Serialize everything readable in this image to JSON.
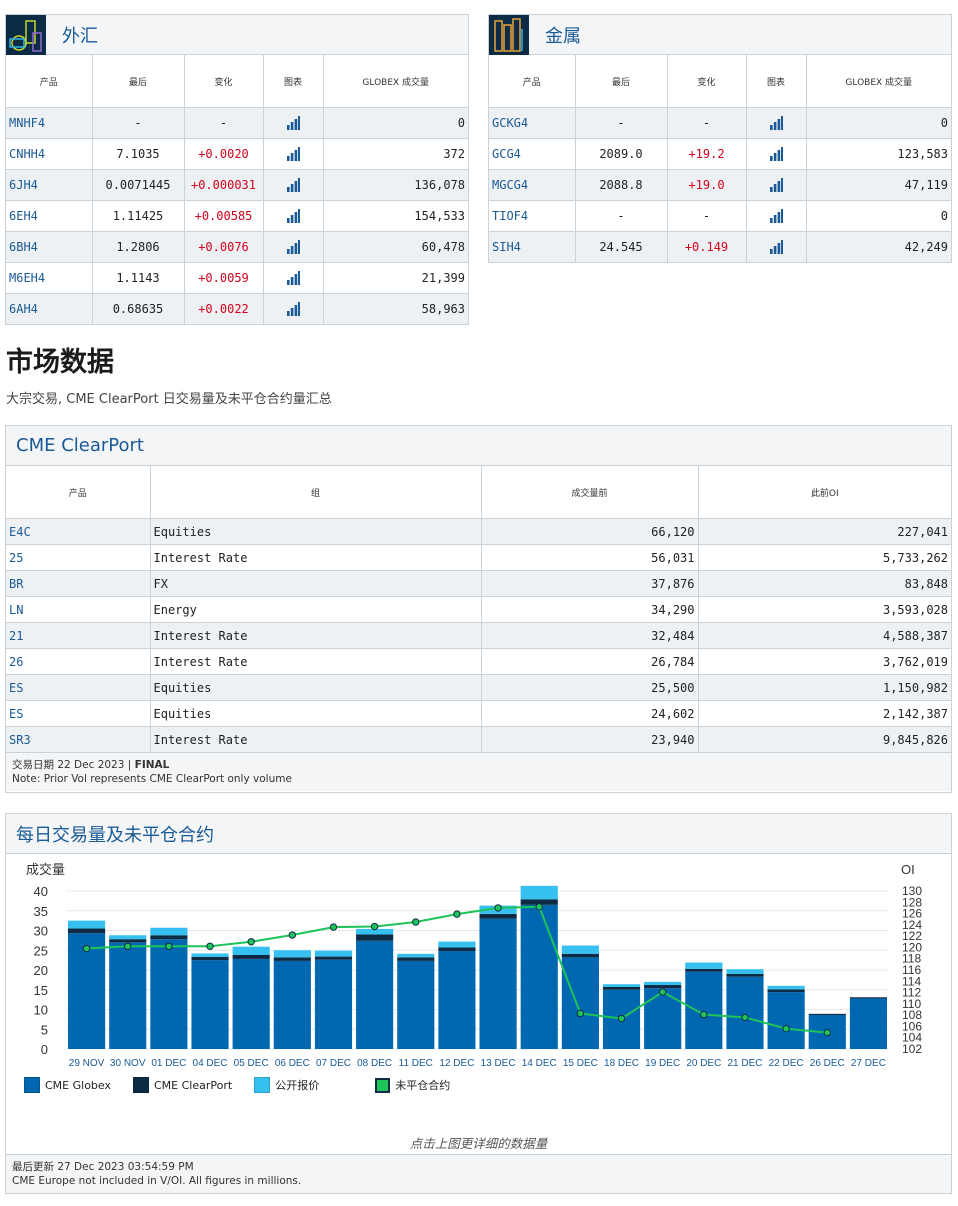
{
  "fx": {
    "title": "外汇",
    "headers": [
      "产品",
      "最后",
      "变化",
      "图表",
      "GLOBEX 成交量"
    ],
    "rows": [
      {
        "code": "MNHF4",
        "last": "-",
        "change": "-",
        "volume": "0"
      },
      {
        "code": "CNHH4",
        "last": "7.1035",
        "change": "+0.0020",
        "volume": "372"
      },
      {
        "code": "6JH4",
        "last": "0.0071445",
        "change": "+0.000031",
        "volume": "136,078"
      },
      {
        "code": "6EH4",
        "last": "1.11425",
        "change": "+0.00585",
        "volume": "154,533"
      },
      {
        "code": "6BH4",
        "last": "1.2806",
        "change": "+0.0076",
        "volume": "60,478"
      },
      {
        "code": "M6EH4",
        "last": "1.1143",
        "change": "+0.0059",
        "volume": "21,399"
      },
      {
        "code": "6AH4",
        "last": "0.68635",
        "change": "+0.0022",
        "volume": "58,963"
      }
    ]
  },
  "metals": {
    "title": "金属",
    "headers": [
      "产品",
      "最后",
      "变化",
      "图表",
      "GLOBEX 成交量"
    ],
    "rows": [
      {
        "code": "GCKG4",
        "last": "-",
        "change": "-",
        "volume": "0"
      },
      {
        "code": "GCG4",
        "last": "2089.0",
        "change": "+19.2",
        "volume": "123,583"
      },
      {
        "code": "MGCG4",
        "last": "2088.8",
        "change": "+19.0",
        "volume": "47,119"
      },
      {
        "code": "TIOF4",
        "last": "-",
        "change": "-",
        "volume": "0"
      },
      {
        "code": "SIH4",
        "last": "24.545",
        "change": "+0.149",
        "volume": "42,249"
      }
    ]
  },
  "market": {
    "title": "市场数据",
    "subtitle": "大宗交易, CME ClearPort 日交易量及未平仓合约量汇总"
  },
  "clearport": {
    "title": "CME ClearPort",
    "headers": [
      "产品",
      "组",
      "成交量前",
      "此前OI"
    ],
    "rows": [
      {
        "code": "E4C",
        "group": "Equities",
        "vol": "66,120",
        "oi": "227,041"
      },
      {
        "code": "25",
        "group": "Interest Rate",
        "vol": "56,031",
        "oi": "5,733,262"
      },
      {
        "code": "BR",
        "group": "FX",
        "vol": "37,876",
        "oi": "83,848"
      },
      {
        "code": "LN",
        "group": "Energy",
        "vol": "34,290",
        "oi": "3,593,028"
      },
      {
        "code": "21",
        "group": "Interest Rate",
        "vol": "32,484",
        "oi": "4,588,387"
      },
      {
        "code": "26",
        "group": "Interest Rate",
        "vol": "26,784",
        "oi": "3,762,019"
      },
      {
        "code": "ES",
        "group": "Equities",
        "vol": "25,500",
        "oi": "1,150,982"
      },
      {
        "code": "ES",
        "group": "Equities",
        "vol": "24,602",
        "oi": "2,142,387"
      },
      {
        "code": "SR3",
        "group": "Interest Rate",
        "vol": "23,940",
        "oi": "9,845,826"
      }
    ],
    "trade_date_label": "交易日期 22 Dec 2023 |",
    "trade_date_status": "FINAL",
    "note": "Note: Prior Vol represents CME ClearPort only volume"
  },
  "daily": {
    "title": "每日交易量及未平仓合约",
    "click_hint": "点击上图更详细的数据量",
    "last_updated": "最后更新 27 Dec 2023 03:54:59 PM",
    "note": "CME Europe not included in V/OI. All figures in millions."
  },
  "colors": {
    "globex": "#0067b1",
    "clearport": "#0d2b45",
    "otc": "#35c0ef",
    "oi": "#1ec35a",
    "link": "#1a5a96",
    "positive": "#d0021b"
  },
  "chart_data": {
    "type": "bar",
    "ylabel": "成交量",
    "y2label": "OI",
    "ylim": [
      0,
      40
    ],
    "yticks": [
      0,
      5,
      10,
      15,
      20,
      25,
      30,
      35,
      40
    ],
    "y2lim": [
      102,
      130
    ],
    "y2ticks": [
      102,
      104,
      106,
      108,
      110,
      112,
      114,
      116,
      118,
      120,
      122,
      124,
      126,
      128,
      130
    ],
    "categories": [
      "29 NOV",
      "30 NOV",
      "01 DEC",
      "04 DEC",
      "05 DEC",
      "06 DEC",
      "07 DEC",
      "08 DEC",
      "11 DEC",
      "12 DEC",
      "13 DEC",
      "14 DEC",
      "15 DEC",
      "18 DEC",
      "19 DEC",
      "20 DEC",
      "21 DEC",
      "22 DEC",
      "26 DEC",
      "27 DEC"
    ],
    "series": [
      {
        "name": "CME Globex",
        "stack": true,
        "values": [
          29.3,
          27.0,
          27.8,
          22.5,
          22.8,
          22.3,
          22.6,
          27.4,
          22.3,
          24.8,
          33.0,
          36.5,
          23.2,
          15.0,
          15.4,
          19.6,
          18.3,
          14.4,
          8.6,
          12.8
        ]
      },
      {
        "name": "CME ClearPort",
        "stack": true,
        "values": [
          1.2,
          0.8,
          1.0,
          0.8,
          1.0,
          0.9,
          0.8,
          1.6,
          0.9,
          0.9,
          1.2,
          1.4,
          0.9,
          0.7,
          0.8,
          0.7,
          0.7,
          0.7,
          0.3,
          0.3
        ]
      },
      {
        "name": "公开报价",
        "stack": true,
        "values": [
          2.0,
          1.0,
          1.9,
          0.9,
          2.1,
          1.8,
          1.5,
          1.4,
          0.9,
          1.5,
          2.1,
          3.4,
          2.1,
          0.7,
          0.8,
          1.6,
          1.2,
          0.9,
          0.0,
          0.0
        ]
      },
      {
        "name": "未平仓合约",
        "axis": "right",
        "values": [
          119.8,
          120.2,
          120.2,
          120.2,
          121.0,
          122.2,
          123.6,
          123.7,
          124.5,
          125.9,
          127.0,
          127.2,
          108.3,
          107.4,
          112.1,
          108.1,
          107.6,
          105.6,
          104.9,
          null
        ]
      }
    ]
  }
}
